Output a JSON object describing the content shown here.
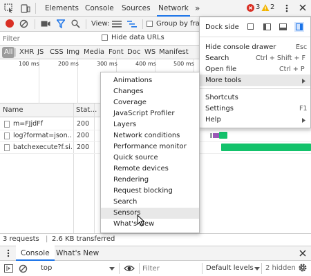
{
  "tabs": {
    "elements": "Elements",
    "console": "Console",
    "sources": "Sources",
    "network": "Network",
    "more": "»",
    "error_count": "3",
    "warning_count": "2"
  },
  "network_toolbar": {
    "view_label": "View:",
    "group_by_frame": "Group by fra"
  },
  "filter": {
    "placeholder": "Filter",
    "hide_data_urls": "Hide data URLs"
  },
  "type_filters": [
    "All",
    "XHR",
    "JS",
    "CSS",
    "Img",
    "Media",
    "Font",
    "Doc",
    "WS",
    "Manifest"
  ],
  "timeline_ticks": [
    "100 ms",
    "200 ms",
    "300 ms",
    "400 ms",
    "500 ms"
  ],
  "grid": {
    "headers": {
      "name": "Name",
      "status": "Stat…"
    },
    "rows": [
      {
        "name": "m=FJjdFf",
        "status": "200"
      },
      {
        "name": "log?format=json…",
        "status": "200"
      },
      {
        "name": "batchexecute?f.si…",
        "status": "200"
      }
    ]
  },
  "status_bar": {
    "requests": "3 requests",
    "divider": "|",
    "transferred": "2.6 KB transferred"
  },
  "drawer": {
    "console_tab": "Console",
    "whats_new_tab": "What's New",
    "context": "top",
    "filter_placeholder": "Filter",
    "levels": "Default levels",
    "hidden": "2 hidden"
  },
  "main_menu": {
    "dock_side": "Dock side",
    "items": [
      {
        "label": "Hide console drawer",
        "shortcut": "Esc"
      },
      {
        "label": "Search",
        "shortcut": "Ctrl + Shift + F"
      },
      {
        "label": "Open file",
        "shortcut": "Ctrl + P"
      },
      {
        "label": "More tools",
        "shortcut": ""
      },
      {
        "label": "Shortcuts",
        "shortcut": ""
      },
      {
        "label": "Settings",
        "shortcut": "F1"
      },
      {
        "label": "Help",
        "shortcut": ""
      }
    ]
  },
  "more_tools_menu": {
    "items": [
      "Animations",
      "Changes",
      "Coverage",
      "JavaScript Profiler",
      "Layers",
      "Network conditions",
      "Performance monitor",
      "Quick source",
      "Remote devices",
      "Rendering",
      "Request blocking",
      "Search",
      "Sensors",
      "What's New"
    ],
    "highlighted": "Sensors"
  },
  "colors": {
    "record_red": "#d93025",
    "active_blue": "#1a73e8",
    "waterfall_green": "#13c26b",
    "waterfall_purple": "#9b59b6",
    "error_red": "#d93025",
    "warning_yellow": "#f2b400"
  }
}
